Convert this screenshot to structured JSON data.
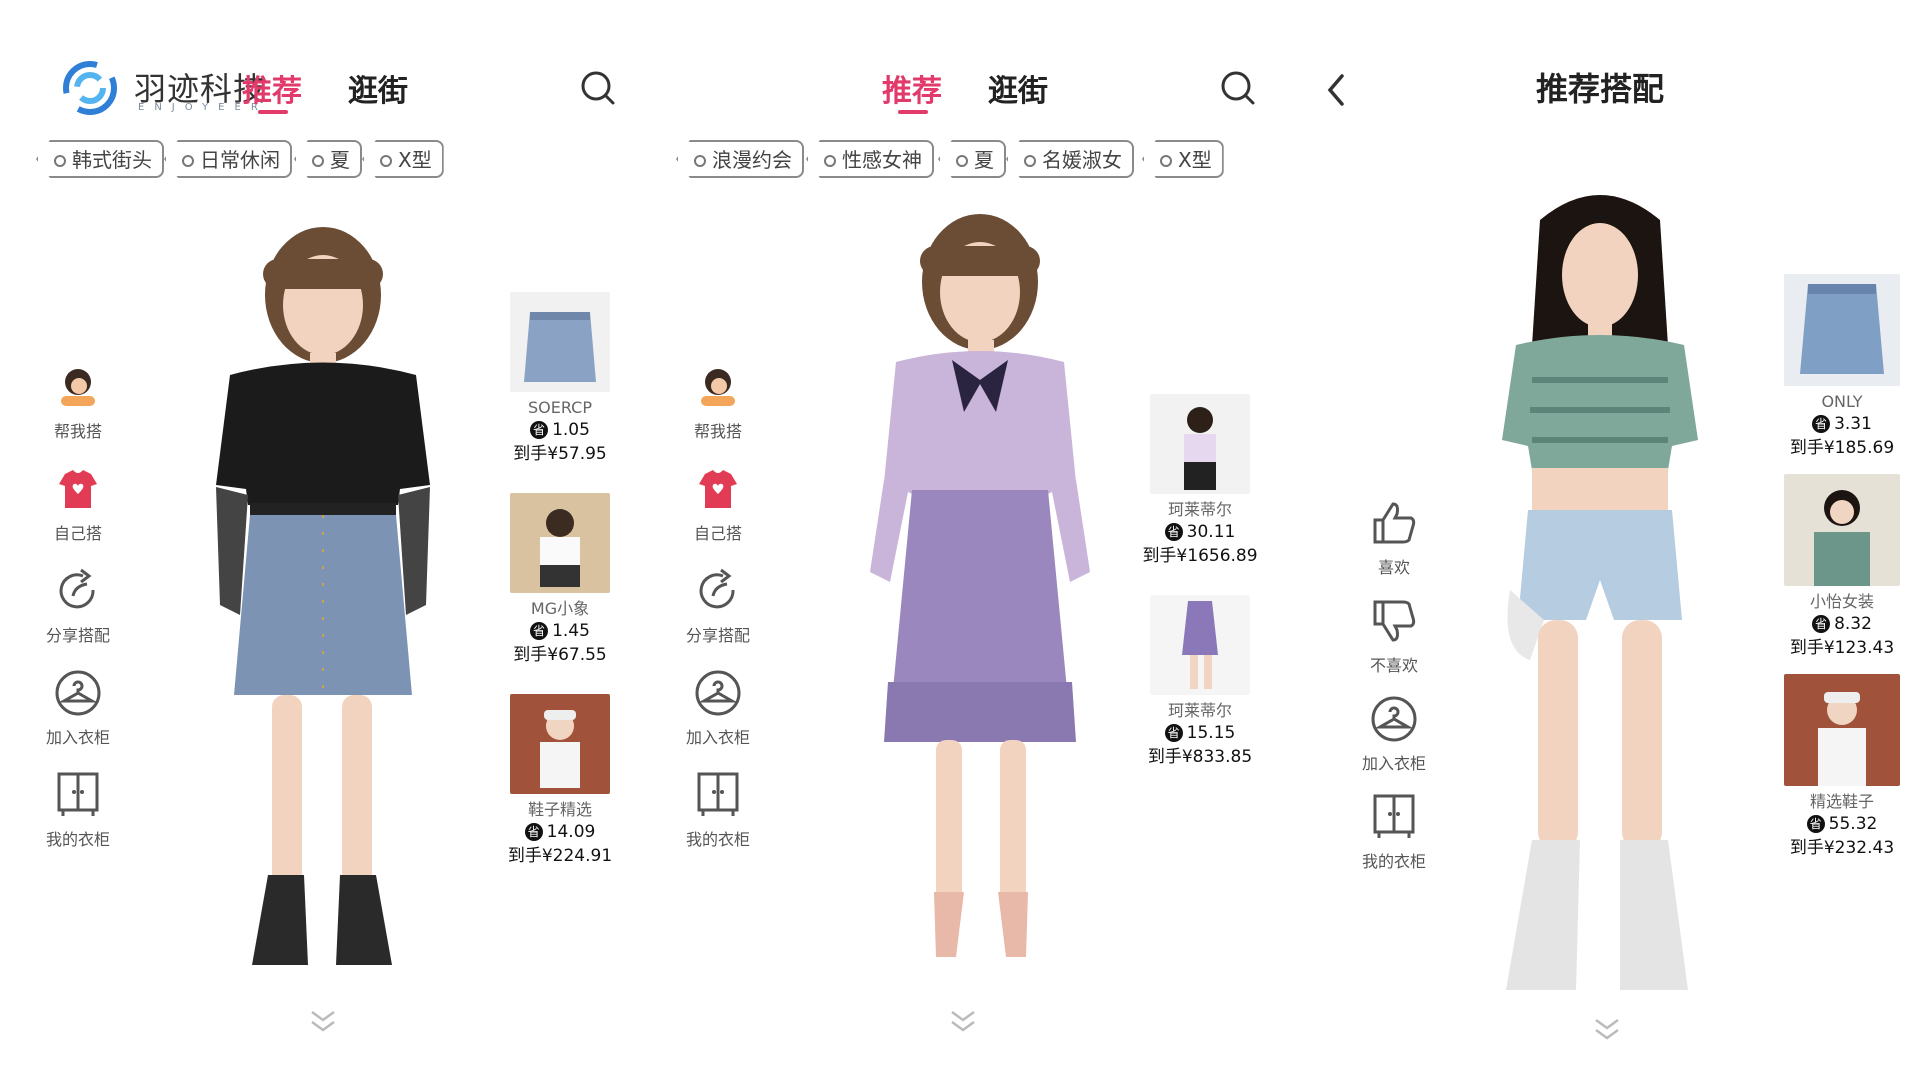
{
  "brand": {
    "name": "羽迹科技",
    "tagline": "ENJOYEER"
  },
  "screen1": {
    "tabs": [
      {
        "label": "推荐"
      },
      {
        "label": "逛街"
      }
    ],
    "tags": [
      "韩式街头",
      "日常休闲",
      "夏",
      "X型"
    ],
    "actions": [
      "帮我搭",
      "自己搭",
      "分享搭配",
      "加入衣柜",
      "我的衣柜"
    ],
    "products": [
      {
        "name": "SOERCP",
        "save": "1.05",
        "price": "到手¥57.95"
      },
      {
        "name": "MG小象",
        "save": "1.45",
        "price": "到手¥67.55"
      },
      {
        "name": "鞋子精选",
        "save": "14.09",
        "price": "到手¥224.91"
      }
    ]
  },
  "screen2": {
    "tabs": [
      {
        "label": "推荐"
      },
      {
        "label": "逛街"
      }
    ],
    "tags": [
      "浪漫约会",
      "性感女神",
      "夏",
      "名媛淑女",
      "X型"
    ],
    "actions": [
      "帮我搭",
      "自己搭",
      "分享搭配",
      "加入衣柜",
      "我的衣柜"
    ],
    "products": [
      {
        "name": "珂莱蒂尔",
        "save": "30.11",
        "price": "到手¥1656.89"
      },
      {
        "name": "珂莱蒂尔",
        "save": "15.15",
        "price": "到手¥833.85"
      }
    ]
  },
  "screen3": {
    "title": "推荐搭配",
    "actions": [
      "喜欢",
      "不喜欢",
      "加入衣柜",
      "我的衣柜"
    ],
    "products": [
      {
        "name": "ONLY",
        "save": "3.31",
        "price": "到手¥185.69"
      },
      {
        "name": "小怡女装",
        "save": "8.32",
        "price": "到手¥123.43"
      },
      {
        "name": "精选鞋子",
        "save": "55.32",
        "price": "到手¥232.43"
      }
    ]
  },
  "save_badge": "省",
  "colors": {
    "accent": "#e23b6b",
    "logo_blue": "#2f7fd6",
    "icon": "#555555"
  },
  "icons": [
    "search-icon",
    "back-icon",
    "help-me-style-icon",
    "style-myself-icon",
    "share-icon",
    "hanger-icon",
    "wardrobe-icon",
    "thumbs-up-icon",
    "thumbs-down-icon",
    "chevron-down-icon"
  ]
}
